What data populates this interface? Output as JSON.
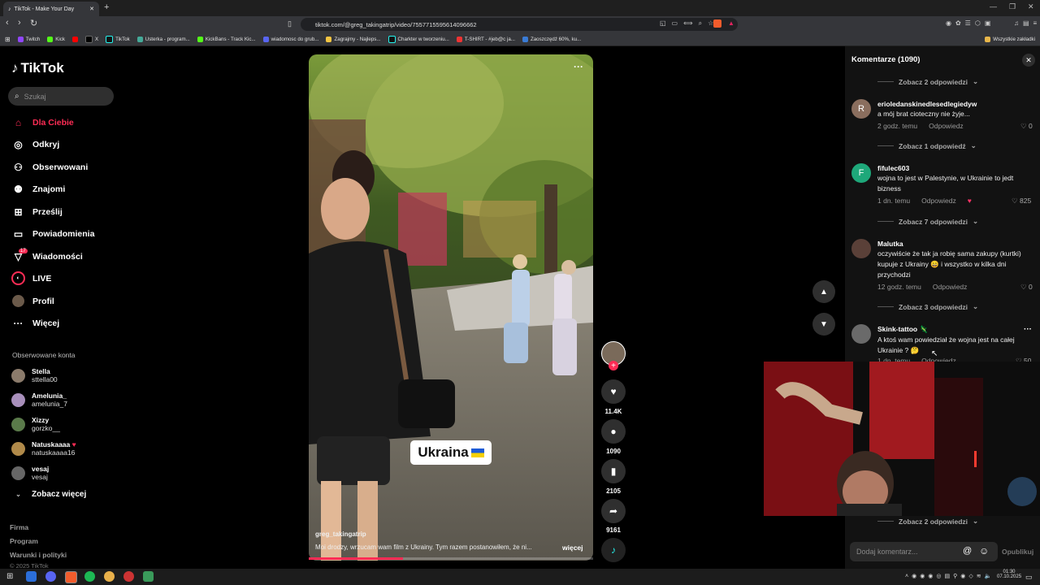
{
  "browser": {
    "tab_title": "TikTok - Make Your Day",
    "url": "tiktok.com/@greg_takingatrip/video/7557715595614096662",
    "bookmarks": [
      "Twitch",
      "Kick",
      "X",
      "TikTok",
      "Usterka - program...",
      "KickBans - Track Kic...",
      "wiadomosc do grub...",
      "Zagrajmy - Najleps...",
      "Charkter w tworzeniu...",
      "T-SHIRT - #jeb@c ja...",
      "Zaoszczędź 60%, ku..."
    ],
    "bookmarks_all": "Wszystkie zakładki"
  },
  "sidebar": {
    "logo": "TikTok",
    "search_placeholder": "Szukaj",
    "nav": [
      {
        "label": "Dla Ciebie",
        "icon": "home-icon"
      },
      {
        "label": "Odkryj",
        "icon": "compass-icon"
      },
      {
        "label": "Obserwowani",
        "icon": "following-icon"
      },
      {
        "label": "Znajomi",
        "icon": "friends-icon"
      },
      {
        "label": "Prześlij",
        "icon": "upload-icon"
      },
      {
        "label": "Powiadomienia",
        "icon": "notifications-icon"
      },
      {
        "label": "Wiadomości",
        "icon": "messages-icon"
      },
      {
        "label": "LIVE",
        "icon": "live-icon"
      },
      {
        "label": "Profil",
        "icon": "profile-icon"
      },
      {
        "label": "Więcej",
        "icon": "more-icon"
      }
    ],
    "messages_badge": "17",
    "followed_header": "Obserwowane konta",
    "followed": [
      {
        "name": "Stella",
        "handle": "sttella00"
      },
      {
        "name": "Amelunia_",
        "handle": "amelunia_7"
      },
      {
        "name": "Xizzy",
        "handle": "gorzko__"
      },
      {
        "name": "Natuskaaaa",
        "handle": "natuskaaaa16"
      },
      {
        "name": "vesaj",
        "handle": "vesaj"
      }
    ],
    "see_more": "Zobacz więcej",
    "footer": [
      "Firma",
      "Program",
      "Warunki i polityki",
      "© 2025 TikTok"
    ]
  },
  "video": {
    "sticker_text": "Ukraina",
    "author": "greg_takingatrip",
    "description": "Moi drodzy, wrzucam wam film z Ukrainy. Tym razem postanowiłem, że ni...",
    "more": "więcej",
    "progress": 0.33
  },
  "actions": {
    "likes": "11.4K",
    "comments": "1090",
    "saves": "2105",
    "shares": "9161"
  },
  "comments": {
    "title": "Komentarze (1090)",
    "reply_label": "Odpowiedz",
    "replies_top": "Zobacz 2 odpowiedzi",
    "items": [
      {
        "initial": "R",
        "user": "erioledanskinedlesedlegiedyw",
        "text": "a mój brat cioteczny nie żyje...",
        "time": "2 godz. temu",
        "likes": "0",
        "replies": "Zobacz 1 odpowiedź"
      },
      {
        "initial": "F",
        "user": "fifulec603",
        "text": "wojna to jest w Palestynie, w Ukrainie to jedt bizness",
        "time": "1 dn. temu",
        "likes": "825",
        "replies": "Zobacz 7 odpowiedzi"
      },
      {
        "initial": "",
        "user": "Malutka",
        "text": "oczywiście że tak ja robię sama zakupy (kurtki) kupuje z Ukrainy 😄 i wszystko w kilka dni przychodzi",
        "time": "12 godz. temu",
        "likes": "0",
        "replies": "Zobacz 3 odpowiedzi"
      },
      {
        "initial": "",
        "user": "Skink-tattoo",
        "text": "A ktoś wam powiedział że wojna jest na całej Ukrainie ? 🤔",
        "time": "1 dn. temu",
        "likes": "50",
        "replies": "Zobacz 2 odpowiedzi"
      }
    ],
    "input_placeholder": "Dodaj komentarz...",
    "publish": "Opublikuj"
  },
  "taskbar": {
    "time": "01:30",
    "date": "07.10.2025"
  }
}
